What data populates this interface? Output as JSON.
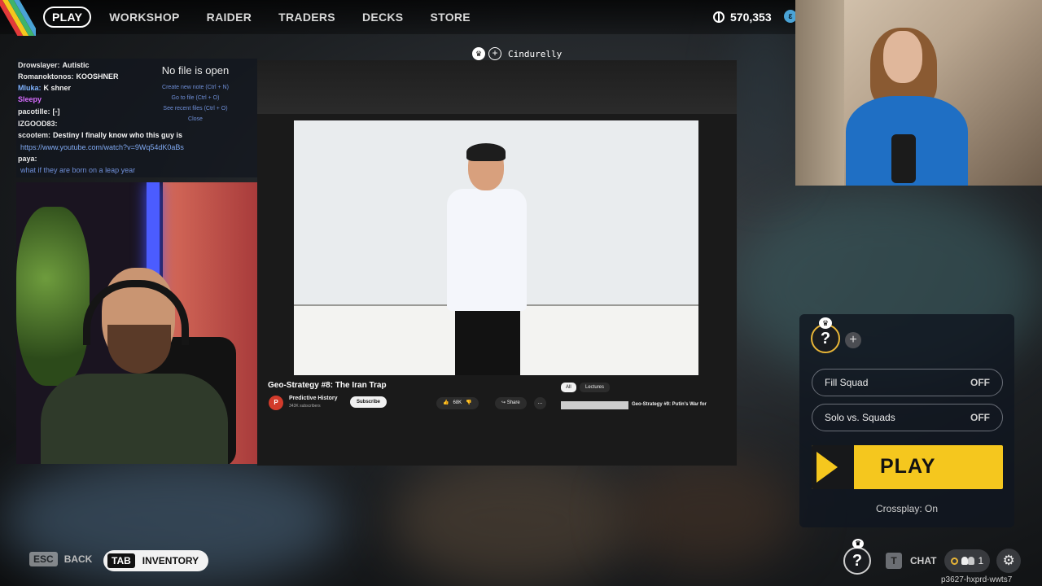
{
  "nav": {
    "items": [
      {
        "label": "PLAY",
        "active": true
      },
      {
        "label": "WORKSHOP",
        "active": false
      },
      {
        "label": "RAIDER",
        "active": false
      },
      {
        "label": "TRADERS",
        "active": false
      },
      {
        "label": "DECKS",
        "active": false
      },
      {
        "label": "STORE",
        "active": false
      }
    ],
    "currency": "570,353",
    "currency_icon": "coin-icon"
  },
  "squad": {
    "leader_name": "Cindurelly"
  },
  "chat": {
    "lines": [
      {
        "name": "Drowslayer:",
        "name_color": "#e6e6e6",
        "message": "Autistic"
      },
      {
        "name": "Romanoktonos:",
        "name_color": "#e6e6e6",
        "message": "KOOSHNER"
      },
      {
        "name": "Mluka:",
        "name_color": "#7fb3ff",
        "message": "K shner"
      },
      {
        "name": "Sleepy",
        "name_color": "#d76cff",
        "message": ""
      },
      {
        "name": "pacotille:",
        "name_color": "#e6e6e6",
        "message": "[-]"
      },
      {
        "name": "IZGOOD83:",
        "name_color": "#e6e6e6",
        "message": ""
      },
      {
        "name": "scootem:",
        "name_color": "#e6e6e6",
        "message": "Destiny I finally know who this guy is"
      },
      {
        "name": "",
        "name_color": "#e6e6e6",
        "message": "https://www.youtube.com/watch?v=9Wq54dK0aBs"
      },
      {
        "name": "paya:",
        "name_color": "#e6e6e6",
        "message": ""
      },
      {
        "name": "",
        "name_color": "#6f8fd8",
        "message": "what if they are born on a leap year"
      }
    ]
  },
  "obsidian": {
    "title": "No file is open",
    "links": [
      "Create new note (Ctrl + N)",
      "Go to file (Ctrl + O)",
      "See recent files (Ctrl + O)",
      "Close"
    ]
  },
  "youtube": {
    "title": "Geo-Strategy #8: The Iran Trap",
    "channel": "Predictive History",
    "channel_initial": "P",
    "subscribers": "343K subscribers",
    "subscribe_label": "Subscribe",
    "likes": "68K",
    "share_label": "Share",
    "more_label": "...",
    "chips": [
      "All",
      "Lectures"
    ],
    "next_video_title": "Geo-Strategy #9: Putin's War for"
  },
  "play_panel": {
    "slot_avatar_label": "?",
    "add_label": "+",
    "fill_squad_label": "Fill Squad",
    "fill_squad_value": "OFF",
    "solo_vs_squads_label": "Solo vs. Squads",
    "solo_vs_squads_value": "OFF",
    "play_label": "PLAY",
    "crossplay": "Crossplay: On"
  },
  "bottom": {
    "esc_key": "ESC",
    "back_label": "BACK",
    "tab_key": "TAB",
    "inventory_label": "INVENTORY",
    "avatar_label": "?",
    "chat_key": "T",
    "chat_label": "CHAT",
    "party_count": "1",
    "settings_icon": "gear-icon",
    "session_id": "p3627-hxprd-wwts7"
  },
  "colors": {
    "accent_yellow": "#f5c71e",
    "panel_bg": "#101620"
  }
}
